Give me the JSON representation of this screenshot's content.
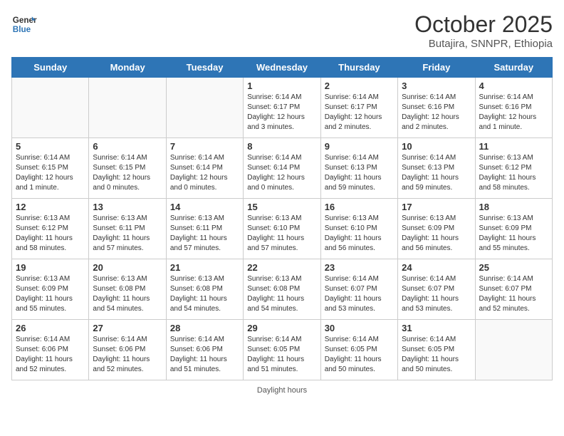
{
  "header": {
    "logo_line1": "General",
    "logo_line2": "Blue",
    "month": "October 2025",
    "location": "Butajira, SNNPR, Ethiopia"
  },
  "days_of_week": [
    "Sunday",
    "Monday",
    "Tuesday",
    "Wednesday",
    "Thursday",
    "Friday",
    "Saturday"
  ],
  "weeks": [
    [
      {
        "day": "",
        "info": ""
      },
      {
        "day": "",
        "info": ""
      },
      {
        "day": "",
        "info": ""
      },
      {
        "day": "1",
        "info": "Sunrise: 6:14 AM\nSunset: 6:17 PM\nDaylight: 12 hours and 3 minutes."
      },
      {
        "day": "2",
        "info": "Sunrise: 6:14 AM\nSunset: 6:17 PM\nDaylight: 12 hours and 2 minutes."
      },
      {
        "day": "3",
        "info": "Sunrise: 6:14 AM\nSunset: 6:16 PM\nDaylight: 12 hours and 2 minutes."
      },
      {
        "day": "4",
        "info": "Sunrise: 6:14 AM\nSunset: 6:16 PM\nDaylight: 12 hours and 1 minute."
      }
    ],
    [
      {
        "day": "5",
        "info": "Sunrise: 6:14 AM\nSunset: 6:15 PM\nDaylight: 12 hours and 1 minute."
      },
      {
        "day": "6",
        "info": "Sunrise: 6:14 AM\nSunset: 6:15 PM\nDaylight: 12 hours and 0 minutes."
      },
      {
        "day": "7",
        "info": "Sunrise: 6:14 AM\nSunset: 6:14 PM\nDaylight: 12 hours and 0 minutes."
      },
      {
        "day": "8",
        "info": "Sunrise: 6:14 AM\nSunset: 6:14 PM\nDaylight: 12 hours and 0 minutes."
      },
      {
        "day": "9",
        "info": "Sunrise: 6:14 AM\nSunset: 6:13 PM\nDaylight: 11 hours and 59 minutes."
      },
      {
        "day": "10",
        "info": "Sunrise: 6:14 AM\nSunset: 6:13 PM\nDaylight: 11 hours and 59 minutes."
      },
      {
        "day": "11",
        "info": "Sunrise: 6:13 AM\nSunset: 6:12 PM\nDaylight: 11 hours and 58 minutes."
      }
    ],
    [
      {
        "day": "12",
        "info": "Sunrise: 6:13 AM\nSunset: 6:12 PM\nDaylight: 11 hours and 58 minutes."
      },
      {
        "day": "13",
        "info": "Sunrise: 6:13 AM\nSunset: 6:11 PM\nDaylight: 11 hours and 57 minutes."
      },
      {
        "day": "14",
        "info": "Sunrise: 6:13 AM\nSunset: 6:11 PM\nDaylight: 11 hours and 57 minutes."
      },
      {
        "day": "15",
        "info": "Sunrise: 6:13 AM\nSunset: 6:10 PM\nDaylight: 11 hours and 57 minutes."
      },
      {
        "day": "16",
        "info": "Sunrise: 6:13 AM\nSunset: 6:10 PM\nDaylight: 11 hours and 56 minutes."
      },
      {
        "day": "17",
        "info": "Sunrise: 6:13 AM\nSunset: 6:09 PM\nDaylight: 11 hours and 56 minutes."
      },
      {
        "day": "18",
        "info": "Sunrise: 6:13 AM\nSunset: 6:09 PM\nDaylight: 11 hours and 55 minutes."
      }
    ],
    [
      {
        "day": "19",
        "info": "Sunrise: 6:13 AM\nSunset: 6:09 PM\nDaylight: 11 hours and 55 minutes."
      },
      {
        "day": "20",
        "info": "Sunrise: 6:13 AM\nSunset: 6:08 PM\nDaylight: 11 hours and 54 minutes."
      },
      {
        "day": "21",
        "info": "Sunrise: 6:13 AM\nSunset: 6:08 PM\nDaylight: 11 hours and 54 minutes."
      },
      {
        "day": "22",
        "info": "Sunrise: 6:13 AM\nSunset: 6:08 PM\nDaylight: 11 hours and 54 minutes."
      },
      {
        "day": "23",
        "info": "Sunrise: 6:14 AM\nSunset: 6:07 PM\nDaylight: 11 hours and 53 minutes."
      },
      {
        "day": "24",
        "info": "Sunrise: 6:14 AM\nSunset: 6:07 PM\nDaylight: 11 hours and 53 minutes."
      },
      {
        "day": "25",
        "info": "Sunrise: 6:14 AM\nSunset: 6:07 PM\nDaylight: 11 hours and 52 minutes."
      }
    ],
    [
      {
        "day": "26",
        "info": "Sunrise: 6:14 AM\nSunset: 6:06 PM\nDaylight: 11 hours and 52 minutes."
      },
      {
        "day": "27",
        "info": "Sunrise: 6:14 AM\nSunset: 6:06 PM\nDaylight: 11 hours and 52 minutes."
      },
      {
        "day": "28",
        "info": "Sunrise: 6:14 AM\nSunset: 6:06 PM\nDaylight: 11 hours and 51 minutes."
      },
      {
        "day": "29",
        "info": "Sunrise: 6:14 AM\nSunset: 6:05 PM\nDaylight: 11 hours and 51 minutes."
      },
      {
        "day": "30",
        "info": "Sunrise: 6:14 AM\nSunset: 6:05 PM\nDaylight: 11 hours and 50 minutes."
      },
      {
        "day": "31",
        "info": "Sunrise: 6:14 AM\nSunset: 6:05 PM\nDaylight: 11 hours and 50 minutes."
      },
      {
        "day": "",
        "info": ""
      }
    ]
  ],
  "footer": "Daylight hours"
}
